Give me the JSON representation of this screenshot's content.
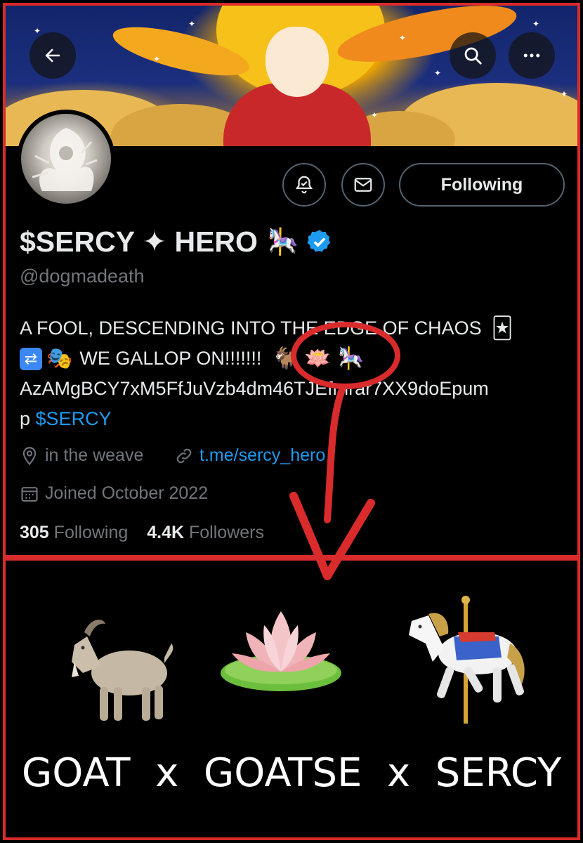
{
  "header": {
    "back_icon": "arrow-left-icon",
    "search_icon": "search-icon",
    "more_icon": "more-horizontal-icon"
  },
  "profile": {
    "display_name": "$SERCY ✦ HERO",
    "display_emoji": "carousel-horse",
    "verified": true,
    "handle": "@dogmadeath",
    "follow_button_label": "Following",
    "bio_line1": "A FOOL, DESCENDING INTO THE EDGE OF CHAOS",
    "bio_line2": "WE GALLOP ON!!!!!!!",
    "bio_line3": "AzAMgBCY7xM5FfJuVzb4dm46TJEfmrar7XX9doEpum",
    "bio_line4_prefix": "p ",
    "bio_cashtag": "$SERCY",
    "bio_emojis": [
      "joker-card",
      "shuffle",
      "performing-arts",
      "goat",
      "lotus",
      "carousel-horse"
    ],
    "location": "in the weave",
    "website": "t.me/sercy_hero",
    "joined": "Joined October 2022",
    "following_count": "305",
    "following_label": "Following",
    "followers_count": "4.4K",
    "followers_label": "Followers"
  },
  "colors": {
    "annotation_red": "#d92b2b",
    "link_blue": "#1d9bf0",
    "verified_blue": "#1d9bf0",
    "muted_gray": "#71767b",
    "background": "#000000"
  },
  "caption": {
    "emojis": [
      "goat",
      "lotus",
      "carousel-horse"
    ],
    "text": "GOAT  x  GOATSE  x  SERCY"
  }
}
